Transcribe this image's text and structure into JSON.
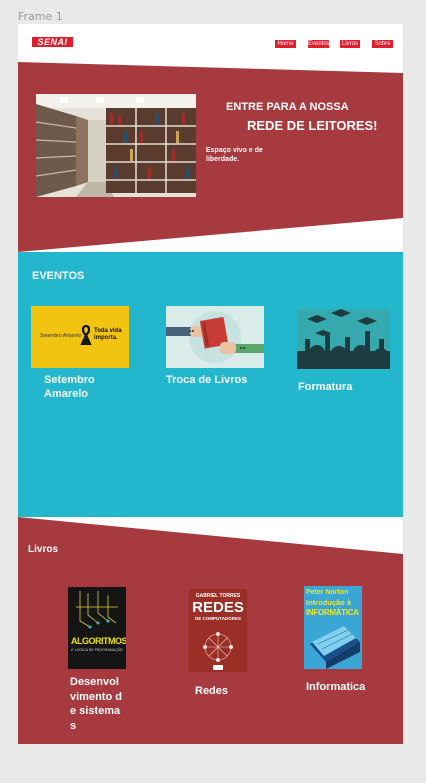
{
  "frame_label": "Frame 1",
  "header": {
    "logo_text": "SENAI",
    "nav": [
      "Home",
      "Eventos",
      "Livros",
      "Sobre"
    ]
  },
  "hero": {
    "title_line1": "ENTRE PARA A NOSSA",
    "title_line2": "REDE DE LEITORES!",
    "subtitle": "Espaço vivo e de liberdade."
  },
  "eventos": {
    "title": "EVENTOS",
    "items": [
      {
        "label": "Setembro Amarelo",
        "banner_small": "Setembro Amarelo",
        "banner_big": "Toda vida importa."
      },
      {
        "label": "Troca de Livros"
      },
      {
        "label": "Formatura"
      }
    ]
  },
  "livros": {
    "title": "Livros",
    "items": [
      {
        "label": "Desenvolvimento de sistemas",
        "cover_title": "ALGORITMOS",
        "cover_sub": "E LÓGICA DE PROGRAMAÇÃO"
      },
      {
        "label": "Redes",
        "cover_author": "GABRIEL TORRES",
        "cover_title": "REDES",
        "cover_sub": "DE COMPUTADORES"
      },
      {
        "label": "Informatica",
        "cover_author": "Peter Norton",
        "cover_title1": "Introdução à",
        "cover_title2": "INFORMÁTICA"
      }
    ]
  },
  "colors": {
    "maroon": "#a63a3f",
    "teal": "#22b7cc",
    "senai_red": "#e01f2d",
    "yellow": "#f2c412"
  }
}
